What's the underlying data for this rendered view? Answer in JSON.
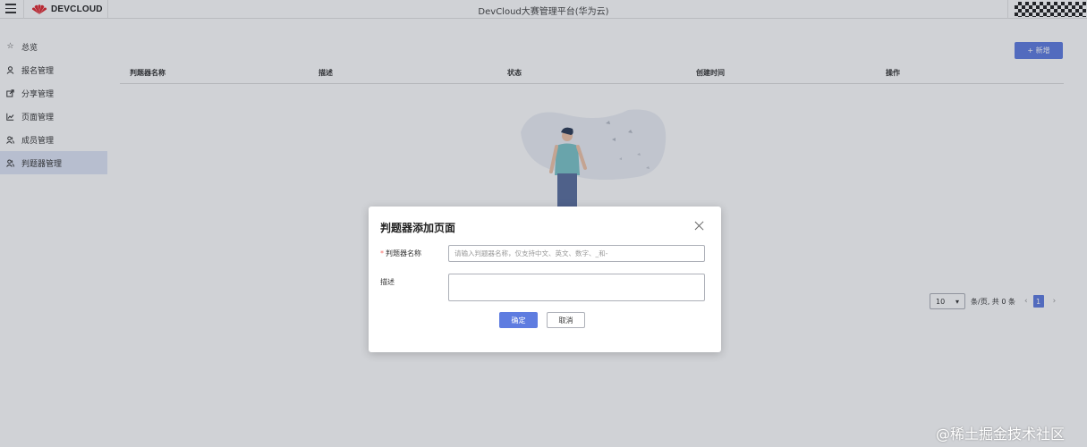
{
  "header": {
    "logo_text": "DEVCLOUD",
    "title": "DevCloud大赛管理平台(华为云)"
  },
  "sidebar": {
    "items": [
      {
        "label": "总览",
        "icon": "star-icon"
      },
      {
        "label": "报名管理",
        "icon": "user-icon"
      },
      {
        "label": "分享管理",
        "icon": "share-icon"
      },
      {
        "label": "页面管理",
        "icon": "chart-icon"
      },
      {
        "label": "成员管理",
        "icon": "members-icon"
      },
      {
        "label": "判题器管理",
        "icon": "members-icon",
        "active": true
      }
    ]
  },
  "main": {
    "add_button": "+ 新增",
    "columns": [
      "判题器名称",
      "描述",
      "状态",
      "创建时间",
      "操作"
    ],
    "pagination": {
      "page_size": "10",
      "summary": "条/页, 共 0 条",
      "current_page": "1"
    }
  },
  "dialog": {
    "title": "判题器添加页面",
    "name_label": "判题器名称",
    "name_placeholder": "请输入判题器名称，仅支持中文、英文、数字、_和-",
    "desc_label": "描述",
    "ok_label": "确定",
    "cancel_label": "取消"
  },
  "watermark": "@稀土掘金技术社区",
  "colors": {
    "primary": "#5e7ce0",
    "active_bg": "#dfe6f6"
  }
}
